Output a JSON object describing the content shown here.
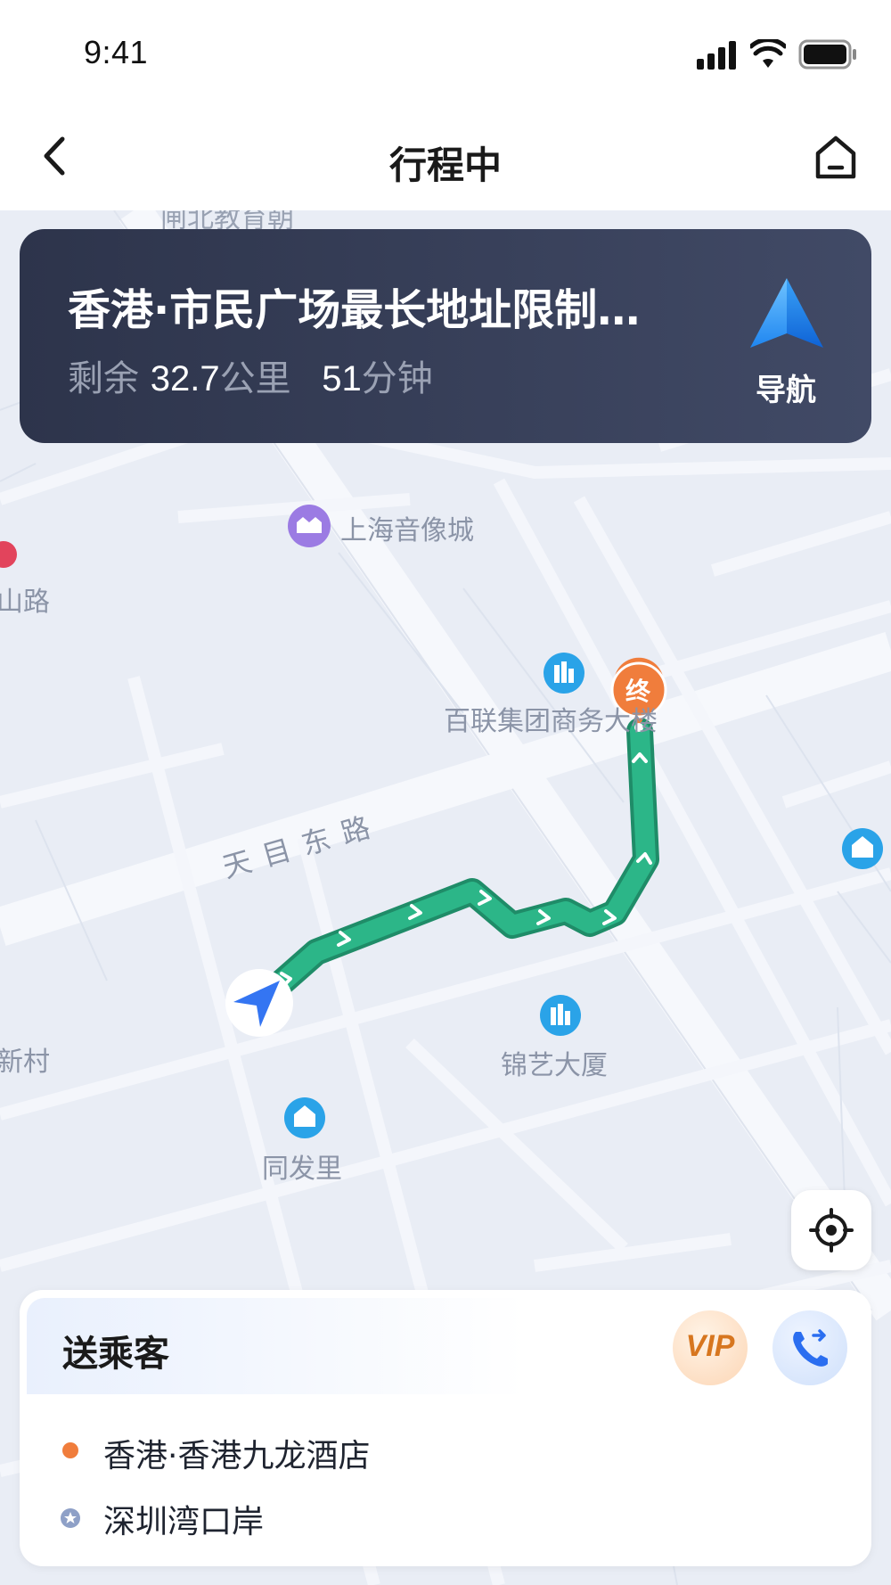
{
  "status_bar": {
    "time": "9:41"
  },
  "nav": {
    "title": "行程中",
    "back_icon": "chevron-left-icon",
    "home_icon": "home-icon"
  },
  "destination": {
    "name": "香港·市民广场最长地址限制…",
    "remaining_label": "剩余",
    "distance_value": "32.7",
    "distance_unit": "公里",
    "time_value": "51",
    "time_unit": "分钟",
    "navigate_label": "导航"
  },
  "map": {
    "pois": {
      "top_cut": "闸北教育朝",
      "music_city": "上海音像城",
      "left_road": "山路",
      "bailian": "百联集团商务大楼",
      "jinyi": "锦艺大厦",
      "tongfa": "同发里",
      "xincun": "新村"
    },
    "road": "天目东路",
    "end_marker": "终",
    "route_color": "#27ad80"
  },
  "panel": {
    "title": "送乘客",
    "vip_label": "VIP",
    "pickup": "香港·香港九龙酒店",
    "dropoff": "深圳湾口岸",
    "pickup_color": "#f07d3c",
    "dropoff_color": "#8ea0c7"
  }
}
